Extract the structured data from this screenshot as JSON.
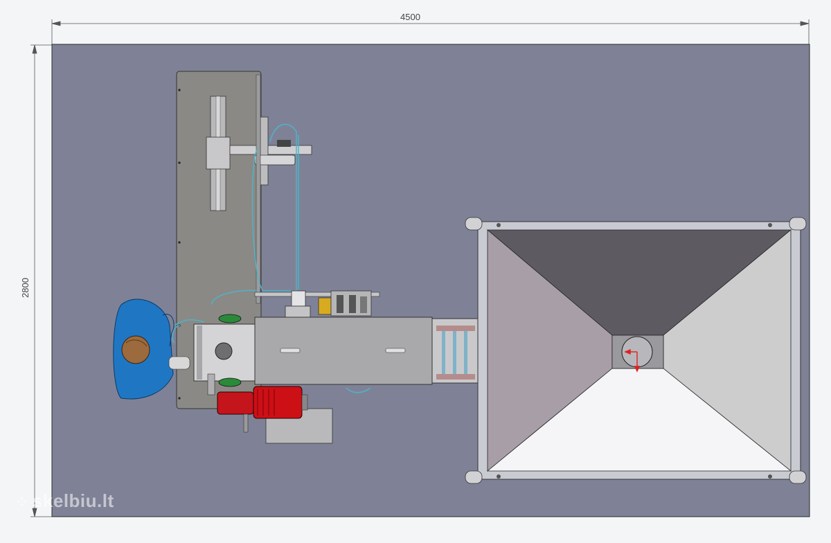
{
  "drawing": {
    "width_dimension": "4500",
    "height_dimension": "2800"
  },
  "watermark": {
    "text": "skelbiu.lt"
  },
  "colors": {
    "floor": "#7f8296",
    "background": "#f4f5f7",
    "panel": "#8a8985",
    "hopper_frame": "#c9cbd3",
    "hopper_top_face": "#5e5a62",
    "hopper_left_face": "#a89ea8",
    "hopper_right_face": "#cdcdcd",
    "hopper_bottom_face": "#f5f5f7",
    "conveyor": "#a9a9ab",
    "motor": "#cc1016",
    "gearbox": "#c4141c",
    "person": "#1f77c4",
    "person_head": "#9c6a3c",
    "hose": "#4fb3c9",
    "arrow": "#e02020"
  }
}
